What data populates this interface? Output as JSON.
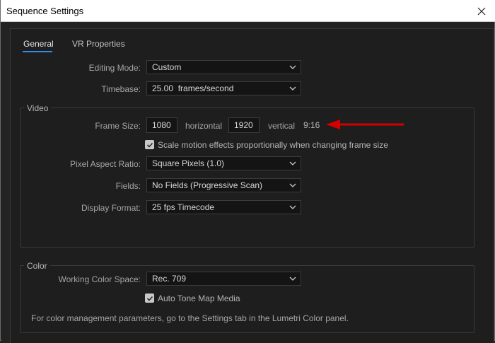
{
  "window": {
    "title": "Sequence Settings"
  },
  "tabs": [
    {
      "label": "General",
      "active": true
    },
    {
      "label": "VR Properties",
      "active": false
    }
  ],
  "general": {
    "editing_mode": {
      "label": "Editing Mode:",
      "value": "Custom"
    },
    "timebase": {
      "label": "Timebase:",
      "value": "25.00  frames/second"
    }
  },
  "video": {
    "title": "Video",
    "frame_size": {
      "label": "Frame Size:",
      "horizontal_value": "1080",
      "horizontal_label": "horizontal",
      "vertical_value": "1920",
      "vertical_label": "vertical",
      "aspect": "9:16"
    },
    "scale_motion": {
      "label": "Scale motion effects proportionally when changing frame size",
      "checked": true
    },
    "pixel_aspect_ratio": {
      "label": "Pixel Aspect Ratio:",
      "value": "Square Pixels (1.0)"
    },
    "fields": {
      "label": "Fields:",
      "value": "No Fields (Progressive Scan)"
    },
    "display_format": {
      "label": "Display Format:",
      "value": "25 fps Timecode"
    }
  },
  "color": {
    "title": "Color",
    "working_color_space": {
      "label": "Working Color Space:",
      "value": "Rec. 709"
    },
    "auto_tone_map": {
      "label": "Auto Tone Map Media",
      "checked": true
    },
    "note": "For color management parameters, go to the Settings tab in the Lumetri Color panel."
  },
  "colors": {
    "accent": "#2d8ceb",
    "annotation_arrow": "#d40000"
  }
}
